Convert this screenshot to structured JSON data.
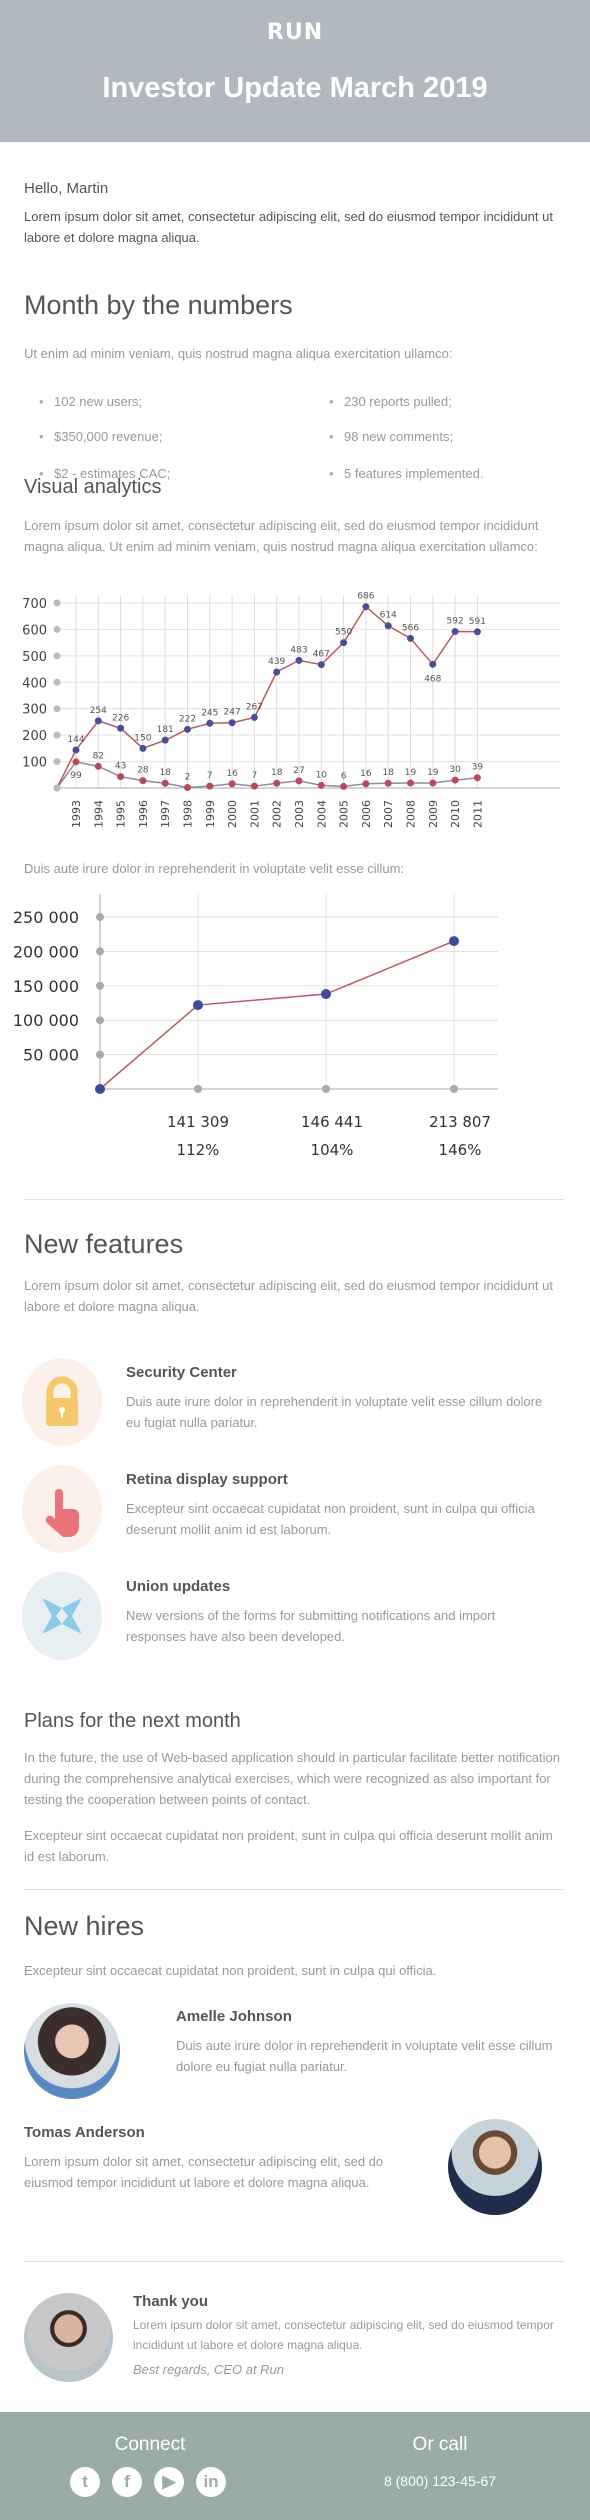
{
  "header": {
    "logo": "RUN",
    "title": "Investor Update March 2019",
    "bg": "#b1b8bf"
  },
  "intro": {
    "greeting": "Hello, Martin",
    "text": "Lorem ipsum dolor sit amet, consectetur adipiscing elit, sed do eiusmod tempor incididunt ut labore et dolore magna aliqua."
  },
  "numbers": {
    "title": "Month by the numbers",
    "subtitle": "Ut enim ad minim veniam, quis nostrud magna aliqua exercitation ullamco:",
    "left": [
      "102 new users;",
      "$350,000 revenue;",
      "$2 - estimates CAC;"
    ],
    "right": [
      "230 reports pulled;",
      "98 new comments;",
      "5 features implemented."
    ]
  },
  "analytics": {
    "title": "Visual analytics",
    "text": "Lorem ipsum dolor sit amet, consectetur adipiscing elit, sed do eiusmod tempor incididunt magna aliqua. Ut enim ad minim veniam, quis nostrud magna aliqua exercitation ullamco:",
    "caption2": "Duis aute irure dolor in reprehenderit in voluptate velit esse cillum:"
  },
  "chart_data": [
    {
      "type": "line",
      "ylim": [
        0,
        700
      ],
      "yticks": [
        "100",
        "200",
        "300",
        "400",
        "500",
        "600",
        "700"
      ],
      "grid": true,
      "categories": [
        "1993",
        "1994",
        "1995",
        "1996",
        "1997",
        "1998",
        "1999",
        "2000",
        "2001",
        "2002",
        "2003",
        "2004",
        "2005",
        "2006",
        "2007",
        "2008",
        "2009",
        "2010",
        "2011"
      ],
      "series": [
        {
          "values": [
            144,
            254,
            226,
            150,
            181,
            222,
            245,
            247,
            267,
            439,
            483,
            467,
            550,
            686,
            614,
            566,
            468,
            592,
            591
          ],
          "marker_color": "#4a4f94",
          "line_color": "#b85a5f"
        },
        {
          "values": [
            99,
            82,
            43,
            28,
            18,
            2,
            7,
            16,
            7,
            18,
            27,
            10,
            6,
            16,
            18,
            19,
            19,
            30,
            39
          ],
          "marker_color": "#b84a5a",
          "line_color": "#8a8f9a"
        }
      ]
    },
    {
      "type": "line",
      "ylim": [
        0,
        250000
      ],
      "yticks": [
        "50 000",
        "100 000",
        "150 000",
        "200 000",
        "250 000"
      ],
      "grid": true,
      "x": [
        "",
        "141 309",
        "146 441",
        "213 807"
      ],
      "values": [
        0,
        122000,
        138000,
        215000
      ],
      "value_labels": [
        "141 309",
        "146 441",
        "213 807"
      ],
      "percent_labels": [
        "112%",
        "104%",
        "146%"
      ],
      "marker_color": "#3f4a9a",
      "line_color": "#b85a5f"
    }
  ],
  "features": {
    "title": "New features",
    "text": "Lorem ipsum dolor sit amet, consectetur adipiscing elit, sed do eiusmod tempor incididunt ut labore et dolore magna aliqua.",
    "items": [
      {
        "title": "Security Center",
        "text": "Duis aute irure dolor in reprehenderit in voluptate velit esse cillum dolore eu fugiat nulla pariatur.",
        "icon": "lock-icon",
        "color": "#f5c86a"
      },
      {
        "title": "Retina display support",
        "text": "Excepteur sint occaecat cupidatat non proident, sunt in culpa qui officia deserunt mollit anim id est laborum.",
        "icon": "pointer-hand-icon",
        "color": "#e8737b"
      },
      {
        "title": "Union updates",
        "text": "New versions of the forms for submitting notifications and import responses have also been developed.",
        "icon": "arrows-converge-icon",
        "color": "#8ccbe6"
      }
    ]
  },
  "plans": {
    "title": "Plans for the next month",
    "p1": "In the future, the use of Web-based application should in particular facilitate better notification during the comprehensive analytical exercises, which were recognized as also important for testing the cooperation between points of contact.",
    "p2": "Excepteur sint occaecat cupidatat non proident, sunt in culpa qui officia deserunt mollit anim id est laborum."
  },
  "hires": {
    "title": "New hires",
    "text": "Excepteur sint occaecat cupidatat non proident, sunt in culpa qui officia.",
    "people": [
      {
        "name": "Amelle Johnson",
        "text": "Duis aute irure dolor in reprehenderit in voluptate velit esse cillum dolore eu fugiat nulla pariatur."
      },
      {
        "name": "Tomas Anderson",
        "text": "Lorem ipsum dolor sit amet, consectetur adipiscing elit, sed do eiusmod tempor incididunt ut labore et dolore magna aliqua."
      }
    ]
  },
  "thanks": {
    "title": "Thank you",
    "text": "Lorem ipsum dolor sit amet, consectetur adipiscing elit, sed do eiusmod tempor incididunt ut labore et dolore magna aliqua.",
    "signature": "Best regards, CEO at Run"
  },
  "footer": {
    "connect": "Connect",
    "call": "Or call",
    "phone": "8 (800) 123-45-67",
    "bg": "#9aaca4",
    "social": [
      "twitter-icon",
      "facebook-icon",
      "youtube-icon",
      "linkedin-icon"
    ]
  }
}
